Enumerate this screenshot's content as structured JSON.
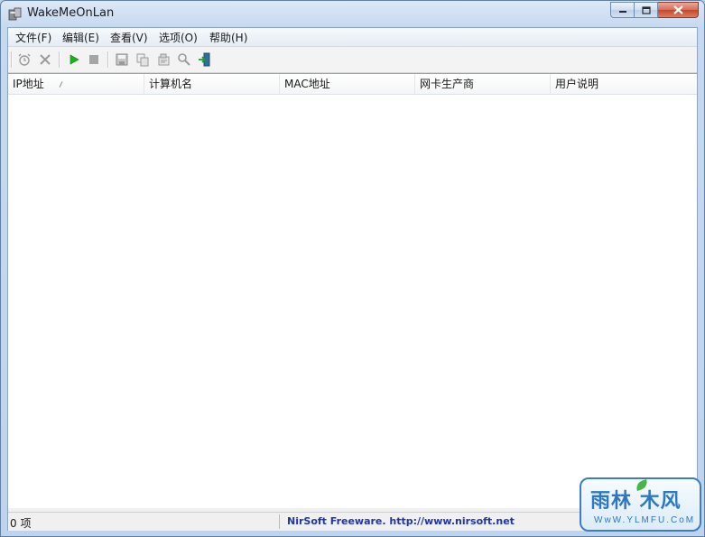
{
  "window": {
    "title": "WakeMeOnLan"
  },
  "menu": [
    {
      "label": "文件(F)"
    },
    {
      "label": "编辑(E)"
    },
    {
      "label": "查看(V)"
    },
    {
      "label": "选项(O)"
    },
    {
      "label": "帮助(H)"
    }
  ],
  "toolbar": {
    "icons": [
      "alarm-clock-icon",
      "delete-icon",
      "play-icon",
      "stop-icon",
      "save-icon",
      "copy-icon",
      "properties-icon",
      "find-icon",
      "exit-icon"
    ]
  },
  "list": {
    "columns": [
      {
        "label": "IP地址"
      },
      {
        "label": "计算机名"
      },
      {
        "label": "MAC地址"
      },
      {
        "label": "网卡生产商"
      },
      {
        "label": "用户说明"
      }
    ],
    "rows": []
  },
  "status": {
    "count": "0 项",
    "link": "NirSoft Freeware.  http://www.nirsoft.net"
  },
  "watermark": {
    "main": "雨林 木风",
    "sub": "WwW.YLMFU.CoM"
  },
  "colors": {
    "link": "#1f35a8",
    "play": "#19b31b",
    "title_bar": "#c6d9ef"
  }
}
